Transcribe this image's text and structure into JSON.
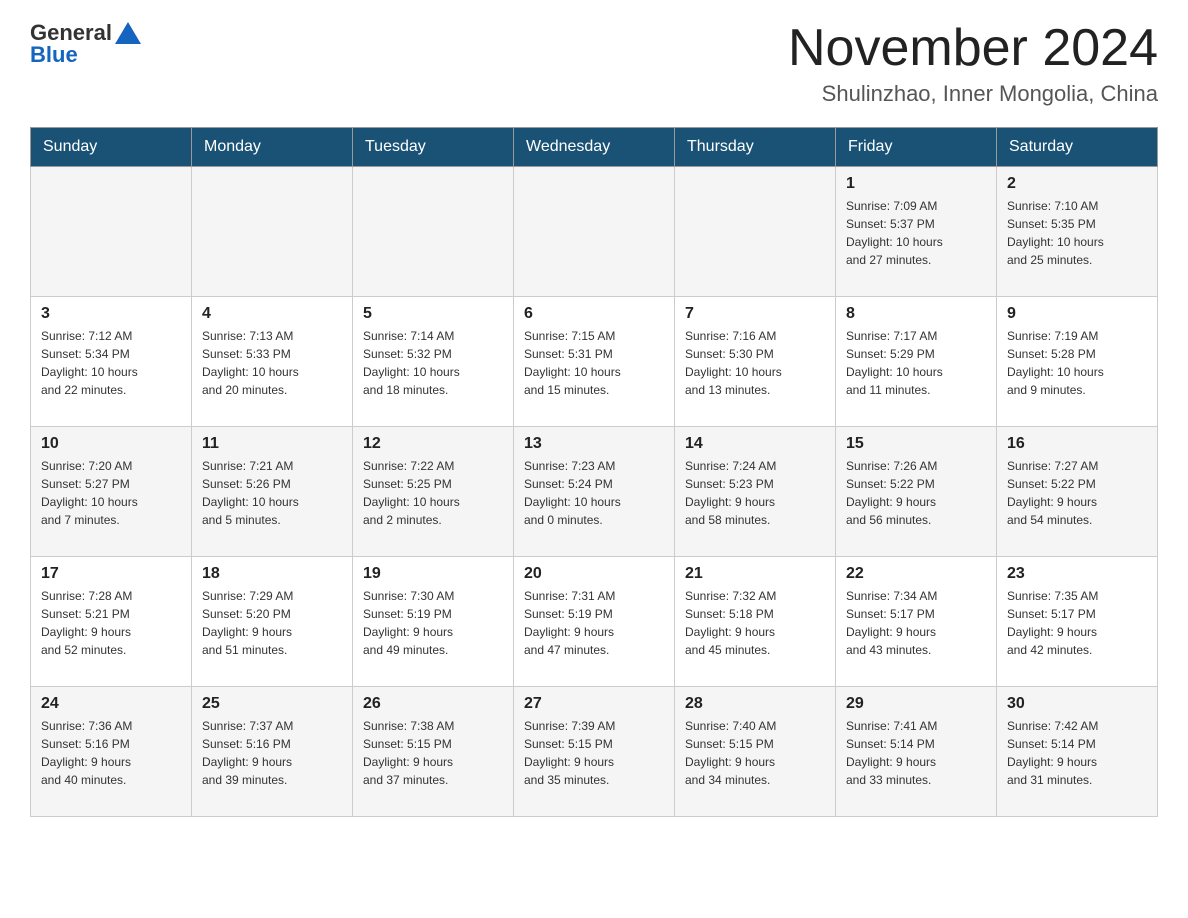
{
  "header": {
    "logo_general": "General",
    "logo_blue": "Blue",
    "month_title": "November 2024",
    "location": "Shulinzhao, Inner Mongolia, China"
  },
  "weekdays": [
    "Sunday",
    "Monday",
    "Tuesday",
    "Wednesday",
    "Thursday",
    "Friday",
    "Saturday"
  ],
  "weeks": [
    [
      {
        "day": "",
        "info": ""
      },
      {
        "day": "",
        "info": ""
      },
      {
        "day": "",
        "info": ""
      },
      {
        "day": "",
        "info": ""
      },
      {
        "day": "",
        "info": ""
      },
      {
        "day": "1",
        "info": "Sunrise: 7:09 AM\nSunset: 5:37 PM\nDaylight: 10 hours\nand 27 minutes."
      },
      {
        "day": "2",
        "info": "Sunrise: 7:10 AM\nSunset: 5:35 PM\nDaylight: 10 hours\nand 25 minutes."
      }
    ],
    [
      {
        "day": "3",
        "info": "Sunrise: 7:12 AM\nSunset: 5:34 PM\nDaylight: 10 hours\nand 22 minutes."
      },
      {
        "day": "4",
        "info": "Sunrise: 7:13 AM\nSunset: 5:33 PM\nDaylight: 10 hours\nand 20 minutes."
      },
      {
        "day": "5",
        "info": "Sunrise: 7:14 AM\nSunset: 5:32 PM\nDaylight: 10 hours\nand 18 minutes."
      },
      {
        "day": "6",
        "info": "Sunrise: 7:15 AM\nSunset: 5:31 PM\nDaylight: 10 hours\nand 15 minutes."
      },
      {
        "day": "7",
        "info": "Sunrise: 7:16 AM\nSunset: 5:30 PM\nDaylight: 10 hours\nand 13 minutes."
      },
      {
        "day": "8",
        "info": "Sunrise: 7:17 AM\nSunset: 5:29 PM\nDaylight: 10 hours\nand 11 minutes."
      },
      {
        "day": "9",
        "info": "Sunrise: 7:19 AM\nSunset: 5:28 PM\nDaylight: 10 hours\nand 9 minutes."
      }
    ],
    [
      {
        "day": "10",
        "info": "Sunrise: 7:20 AM\nSunset: 5:27 PM\nDaylight: 10 hours\nand 7 minutes."
      },
      {
        "day": "11",
        "info": "Sunrise: 7:21 AM\nSunset: 5:26 PM\nDaylight: 10 hours\nand 5 minutes."
      },
      {
        "day": "12",
        "info": "Sunrise: 7:22 AM\nSunset: 5:25 PM\nDaylight: 10 hours\nand 2 minutes."
      },
      {
        "day": "13",
        "info": "Sunrise: 7:23 AM\nSunset: 5:24 PM\nDaylight: 10 hours\nand 0 minutes."
      },
      {
        "day": "14",
        "info": "Sunrise: 7:24 AM\nSunset: 5:23 PM\nDaylight: 9 hours\nand 58 minutes."
      },
      {
        "day": "15",
        "info": "Sunrise: 7:26 AM\nSunset: 5:22 PM\nDaylight: 9 hours\nand 56 minutes."
      },
      {
        "day": "16",
        "info": "Sunrise: 7:27 AM\nSunset: 5:22 PM\nDaylight: 9 hours\nand 54 minutes."
      }
    ],
    [
      {
        "day": "17",
        "info": "Sunrise: 7:28 AM\nSunset: 5:21 PM\nDaylight: 9 hours\nand 52 minutes."
      },
      {
        "day": "18",
        "info": "Sunrise: 7:29 AM\nSunset: 5:20 PM\nDaylight: 9 hours\nand 51 minutes."
      },
      {
        "day": "19",
        "info": "Sunrise: 7:30 AM\nSunset: 5:19 PM\nDaylight: 9 hours\nand 49 minutes."
      },
      {
        "day": "20",
        "info": "Sunrise: 7:31 AM\nSunset: 5:19 PM\nDaylight: 9 hours\nand 47 minutes."
      },
      {
        "day": "21",
        "info": "Sunrise: 7:32 AM\nSunset: 5:18 PM\nDaylight: 9 hours\nand 45 minutes."
      },
      {
        "day": "22",
        "info": "Sunrise: 7:34 AM\nSunset: 5:17 PM\nDaylight: 9 hours\nand 43 minutes."
      },
      {
        "day": "23",
        "info": "Sunrise: 7:35 AM\nSunset: 5:17 PM\nDaylight: 9 hours\nand 42 minutes."
      }
    ],
    [
      {
        "day": "24",
        "info": "Sunrise: 7:36 AM\nSunset: 5:16 PM\nDaylight: 9 hours\nand 40 minutes."
      },
      {
        "day": "25",
        "info": "Sunrise: 7:37 AM\nSunset: 5:16 PM\nDaylight: 9 hours\nand 39 minutes."
      },
      {
        "day": "26",
        "info": "Sunrise: 7:38 AM\nSunset: 5:15 PM\nDaylight: 9 hours\nand 37 minutes."
      },
      {
        "day": "27",
        "info": "Sunrise: 7:39 AM\nSunset: 5:15 PM\nDaylight: 9 hours\nand 35 minutes."
      },
      {
        "day": "28",
        "info": "Sunrise: 7:40 AM\nSunset: 5:15 PM\nDaylight: 9 hours\nand 34 minutes."
      },
      {
        "day": "29",
        "info": "Sunrise: 7:41 AM\nSunset: 5:14 PM\nDaylight: 9 hours\nand 33 minutes."
      },
      {
        "day": "30",
        "info": "Sunrise: 7:42 AM\nSunset: 5:14 PM\nDaylight: 9 hours\nand 31 minutes."
      }
    ]
  ]
}
